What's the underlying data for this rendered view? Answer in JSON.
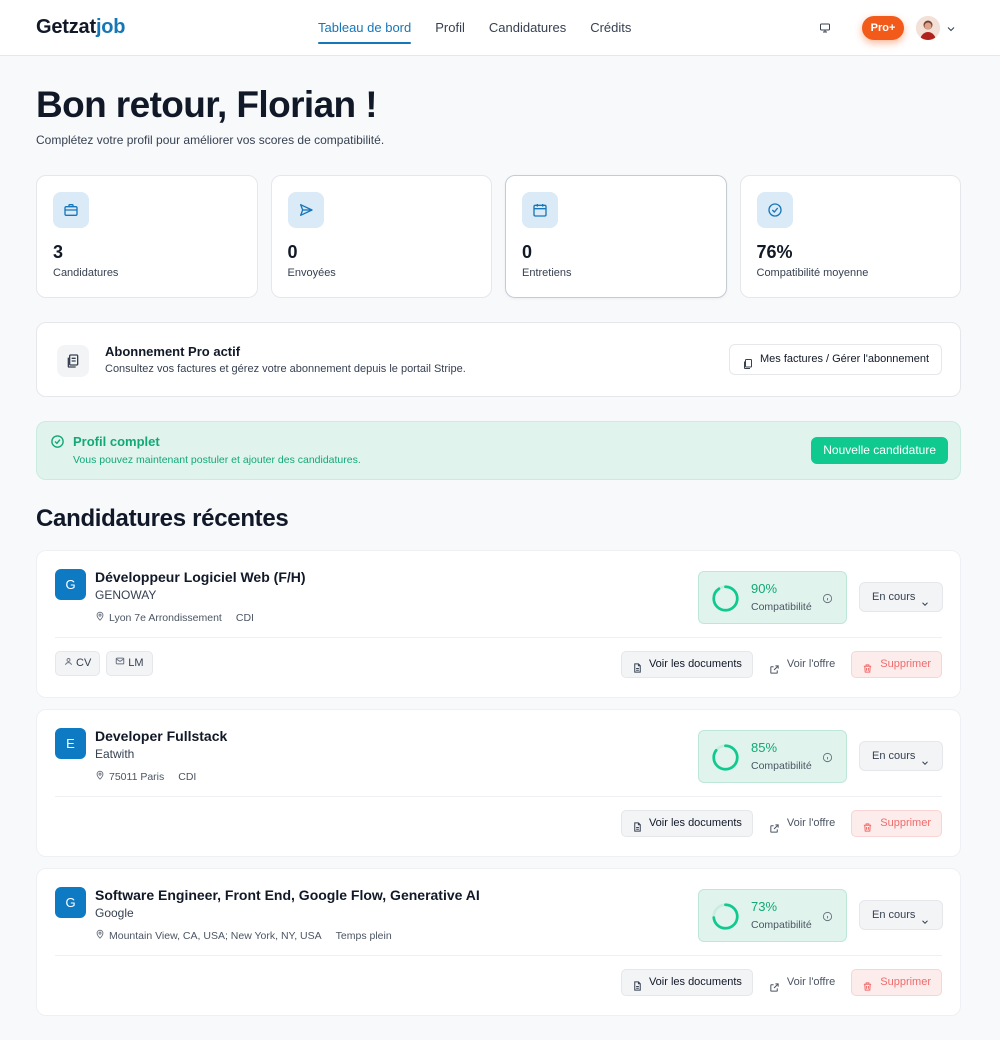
{
  "brand": {
    "part1": "Getzat",
    "part2": "job"
  },
  "nav": {
    "items": [
      {
        "label": "Tableau de bord",
        "active": true
      },
      {
        "label": "Profil",
        "active": false
      },
      {
        "label": "Candidatures",
        "active": false
      },
      {
        "label": "Crédits",
        "active": false
      }
    ]
  },
  "header": {
    "plan_badge": "Pro+",
    "icons": [
      "monitor-icon",
      "avatar",
      "chevron-down-icon"
    ]
  },
  "welcome": {
    "title": "Bon retour, Florian !",
    "subtitle": "Complétez votre profil pour améliorer vos scores de compatibilité."
  },
  "stats": [
    {
      "icon": "briefcase-icon",
      "value": "3",
      "label": "Candidatures"
    },
    {
      "icon": "send-icon",
      "value": "0",
      "label": "Envoyées"
    },
    {
      "icon": "calendar-icon",
      "value": "0",
      "label": "Entretiens"
    },
    {
      "icon": "check-circle-icon",
      "value": "76%",
      "label": "Compatibilité moyenne"
    }
  ],
  "subscription": {
    "title": "Abonnement Pro actif",
    "description": "Consultez vos factures et gérez votre abonnement depuis le portail Stripe.",
    "button": "Mes factures / Gérer l'abonnement"
  },
  "profile_status": {
    "title": "Profil complet",
    "description": "Vous pouvez maintenant postuler et ajouter des candidatures.",
    "button": "Nouvelle candidature"
  },
  "recent": {
    "title": "Candidatures récentes",
    "compat_label": "Compatibilité",
    "actions": {
      "docs": "Voir les documents",
      "offer": "Voir l'offre",
      "delete": "Supprimer"
    },
    "applications": [
      {
        "letter": "G",
        "title": "Développeur Logiciel Web (F/H)",
        "company": "GENOWAY",
        "location": "Lyon 7e Arrondissement",
        "contract": "CDI",
        "compatibility": "90%",
        "compatibility_value": 90,
        "status": "En cours",
        "tags": [
          {
            "icon": "user-icon",
            "label": "CV"
          },
          {
            "icon": "mail-icon",
            "label": "LM"
          }
        ]
      },
      {
        "letter": "E",
        "title": "Developer Fullstack",
        "company": "Eatwith",
        "location": "75011 Paris",
        "contract": "CDI",
        "compatibility": "85%",
        "compatibility_value": 85,
        "status": "En cours",
        "tags": []
      },
      {
        "letter": "G",
        "title": "Software Engineer, Front End, Google Flow, Generative AI",
        "company": "Google",
        "location": "Mountain View, CA, USA; New York, NY, USA",
        "contract": "Temps plein",
        "compatibility": "73%",
        "compatibility_value": 73,
        "status": "En cours",
        "tags": []
      }
    ]
  },
  "colors": {
    "brand": "#1677b8",
    "accent_green": "#10c98f",
    "pro_orange": "#f25a1a",
    "danger": "#ef6b6b"
  }
}
